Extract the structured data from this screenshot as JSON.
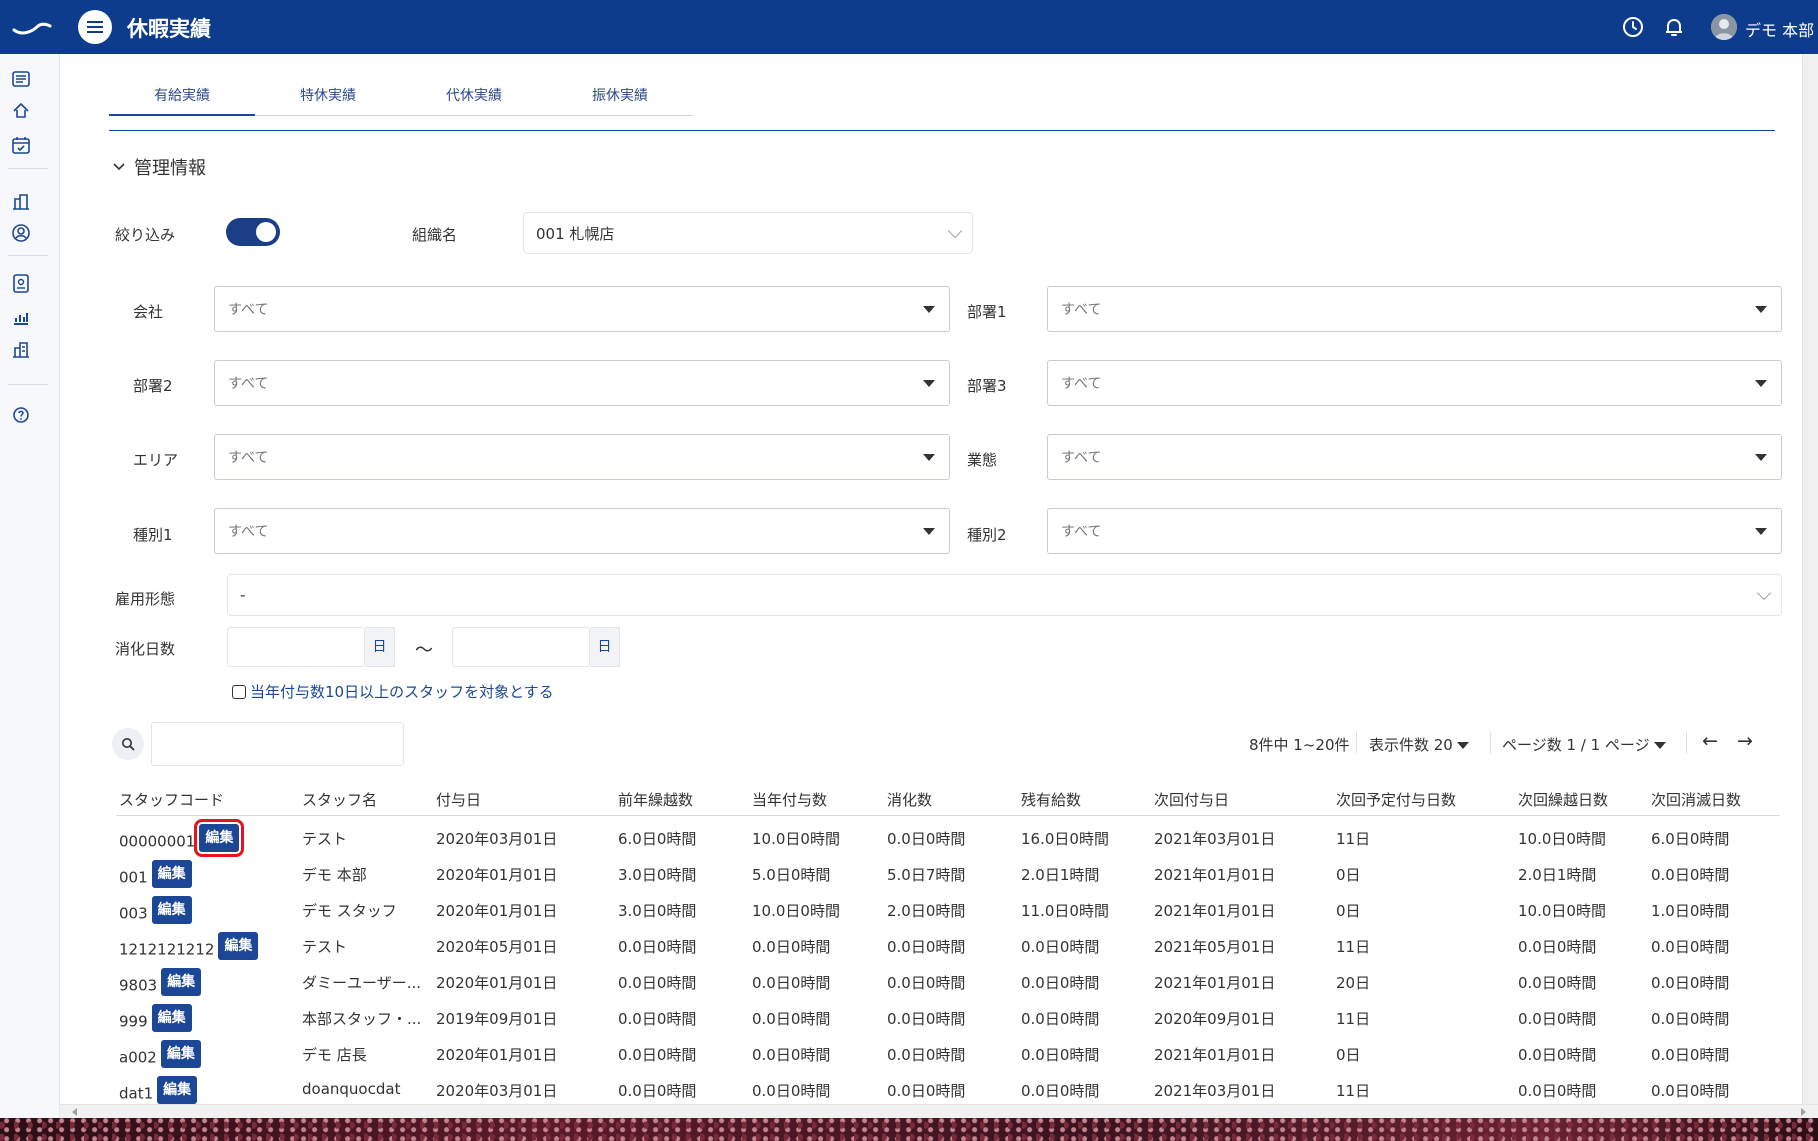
{
  "header": {
    "title": "休暇実績",
    "user_name": "デモ 本部"
  },
  "tabs": [
    {
      "label": "有給実績",
      "active": true
    },
    {
      "label": "特休実績",
      "active": false
    },
    {
      "label": "代休実績",
      "active": false
    },
    {
      "label": "振休実績",
      "active": false
    }
  ],
  "section": {
    "title": "管理情報"
  },
  "filter": {
    "toggle_label": "絞り込み",
    "toggle_on": true,
    "org_label": "組織名",
    "org_value": "001 札幌店"
  },
  "dropdowns": {
    "company": {
      "label": "会社",
      "value": "すべて"
    },
    "dept1": {
      "label": "部署1",
      "value": "すべて"
    },
    "dept2": {
      "label": "部署2",
      "value": "すべて"
    },
    "dept3": {
      "label": "部署3",
      "value": "すべて"
    },
    "area": {
      "label": "エリア",
      "value": "すべて"
    },
    "business": {
      "label": "業態",
      "value": "すべて"
    },
    "type1": {
      "label": "種別1",
      "value": "すべて"
    },
    "type2": {
      "label": "種別2",
      "value": "すべて"
    }
  },
  "employment": {
    "label": "雇用形態",
    "value": "-"
  },
  "consumed_days": {
    "label": "消化日数",
    "unit": "日",
    "tilde": "〜"
  },
  "checkbox_label": "当年付与数10日以上のスタッフを対象とする",
  "pagination": {
    "summary": "8件中 1~20件",
    "per_page": "表示件数 20",
    "page_info": "ページ数 1 / 1 ページ",
    "prev": "←",
    "next": "→"
  },
  "table": {
    "edit_label": "編集",
    "headers": [
      "スタッフコード",
      "スタッフ名",
      "付与日",
      "前年繰越数",
      "当年付与数",
      "消化数",
      "残有給数",
      "次回付与日",
      "次回予定付与日数",
      "次回繰越日数",
      "次回消滅日数"
    ],
    "rows": [
      {
        "code": "00000001",
        "name": "テスト",
        "grant_date": "2020年03月01日",
        "carryover": "6.0日0時間",
        "granted": "10.0日0時間",
        "consumed": "0.0日0時間",
        "remaining": "16.0日0時間",
        "next_grant_date": "2021年03月01日",
        "next_grant_days": "11日",
        "next_carryover": "10.0日0時間",
        "next_expire": "6.0日0時間"
      },
      {
        "code": "001",
        "name": "デモ 本部",
        "grant_date": "2020年01月01日",
        "carryover": "3.0日0時間",
        "granted": "5.0日0時間",
        "consumed": "5.0日7時間",
        "remaining": "2.0日1時間",
        "next_grant_date": "2021年01月01日",
        "next_grant_days": "0日",
        "next_carryover": "2.0日1時間",
        "next_expire": "0.0日0時間"
      },
      {
        "code": "003",
        "name": "デモ スタッフ",
        "grant_date": "2020年01月01日",
        "carryover": "3.0日0時間",
        "granted": "10.0日0時間",
        "consumed": "2.0日0時間",
        "remaining": "11.0日0時間",
        "next_grant_date": "2021年01月01日",
        "next_grant_days": "0日",
        "next_carryover": "10.0日0時間",
        "next_expire": "1.0日0時間"
      },
      {
        "code": "1212121212",
        "name": "テスト",
        "grant_date": "2020年05月01日",
        "carryover": "0.0日0時間",
        "granted": "0.0日0時間",
        "consumed": "0.0日0時間",
        "remaining": "0.0日0時間",
        "next_grant_date": "2021年05月01日",
        "next_grant_days": "11日",
        "next_carryover": "0.0日0時間",
        "next_expire": "0.0日0時間"
      },
      {
        "code": "9803",
        "name": "ダミーユーザー...",
        "grant_date": "2020年01月01日",
        "carryover": "0.0日0時間",
        "granted": "0.0日0時間",
        "consumed": "0.0日0時間",
        "remaining": "0.0日0時間",
        "next_grant_date": "2021年01月01日",
        "next_grant_days": "20日",
        "next_carryover": "0.0日0時間",
        "next_expire": "0.0日0時間"
      },
      {
        "code": "999",
        "name": "本部スタッフ・...",
        "grant_date": "2019年09月01日",
        "carryover": "0.0日0時間",
        "granted": "0.0日0時間",
        "consumed": "0.0日0時間",
        "remaining": "0.0日0時間",
        "next_grant_date": "2020年09月01日",
        "next_grant_days": "11日",
        "next_carryover": "0.0日0時間",
        "next_expire": "0.0日0時間"
      },
      {
        "code": "a002",
        "name": "デモ 店長",
        "grant_date": "2020年01月01日",
        "carryover": "0.0日0時間",
        "granted": "0.0日0時間",
        "consumed": "0.0日0時間",
        "remaining": "0.0日0時間",
        "next_grant_date": "2021年01月01日",
        "next_grant_days": "0日",
        "next_carryover": "0.0日0時間",
        "next_expire": "0.0日0時間"
      },
      {
        "code": "dat1",
        "name": "doanquocdat",
        "grant_date": "2020年03月01日",
        "carryover": "0.0日0時間",
        "granted": "0.0日0時間",
        "consumed": "0.0日0時間",
        "remaining": "0.0日0時間",
        "next_grant_date": "2021年03月01日",
        "next_grant_days": "11日",
        "next_carryover": "0.0日0時間",
        "next_expire": "0.0日0時間"
      }
    ]
  },
  "colors": {
    "header_bg": "#0d3c8c",
    "accent": "#1c4796",
    "highlight": "#e8121a"
  },
  "icons": {
    "logo": "brand-logo-icon",
    "menu": "hamburger-menu-icon",
    "history": "clock-icon",
    "notifications": "bell-icon",
    "section_toggle": "chevron-down-icon",
    "search": "search-icon"
  }
}
